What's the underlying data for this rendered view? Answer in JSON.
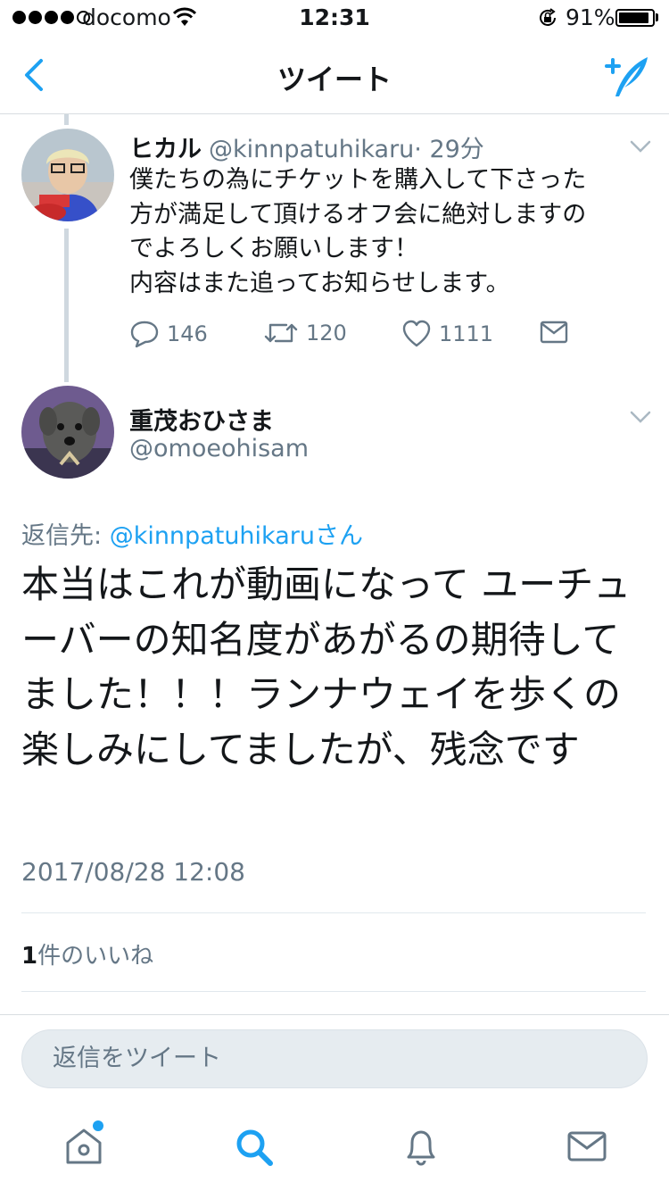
{
  "status_bar": {
    "carrier": "docomo",
    "time": "12:31",
    "battery": "91%",
    "battery_level": 0.91
  },
  "nav": {
    "title": "ツイート"
  },
  "parent_tweet": {
    "name": "ヒカル",
    "handle": "@kinnpatuhikaru",
    "age": "· 29分",
    "text": "僕たちの為にチケットを購入して下さった\n方が満足して頂けるオフ会に絶対しますの\nでよろしくお願いします！\n内容はまた追ってお知らせします。",
    "reply_count": "146",
    "retweet_count": "120",
    "like_count": "1111"
  },
  "main_tweet": {
    "name": "重茂おひさま",
    "handle": "@omoeohisam",
    "reply_prefix": "返信先: ",
    "reply_mention": "@kinnpatuhikaruさん",
    "text": "本当はこれが動画になって ユーチューバーの知名度があがるの期待してました！！！ランナウェイを歩くの楽しみにしてましたが、残念です",
    "timestamp": "2017/08/28 12:08",
    "likes_count": "1",
    "likes_label": "件のいいね"
  },
  "reply_box": {
    "placeholder": "返信をツイート"
  },
  "tabs": [
    {
      "name": "home-icon"
    },
    {
      "name": "search-icon"
    },
    {
      "name": "notifications-icon"
    },
    {
      "name": "messages-icon"
    }
  ],
  "colors": {
    "accent": "#1da1f2",
    "secondary_text": "#657786",
    "primary_text": "#14171a"
  }
}
